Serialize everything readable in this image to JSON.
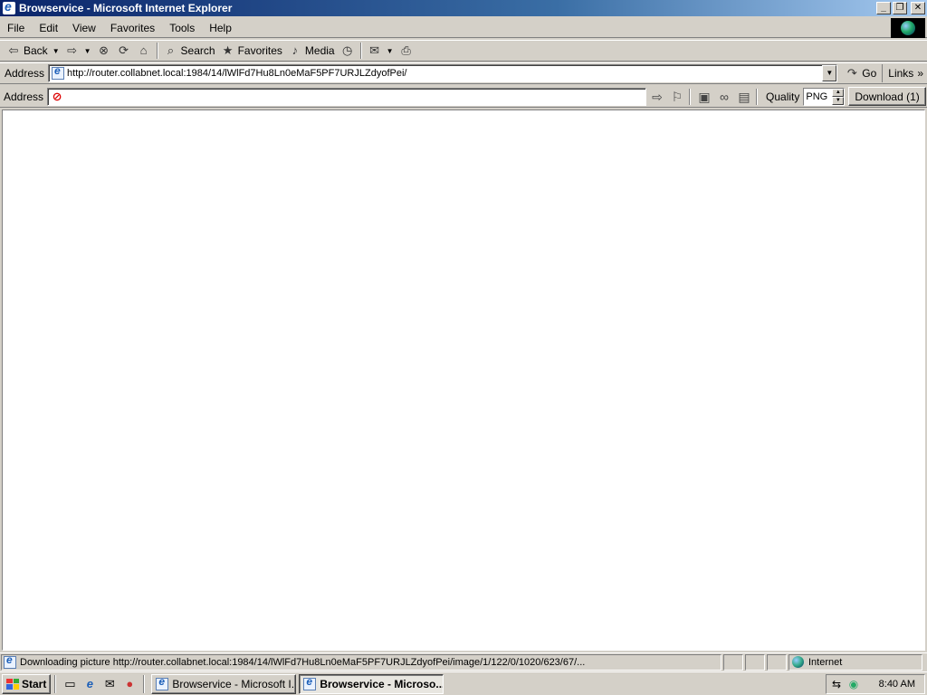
{
  "window": {
    "title": "Browservice - Microsoft Internet Explorer"
  },
  "menu": {
    "items": [
      "File",
      "Edit",
      "View",
      "Favorites",
      "Tools",
      "Help"
    ]
  },
  "toolbar": {
    "back_label": "Back",
    "search_label": "Search",
    "favorites_label": "Favorites",
    "media_label": "Media"
  },
  "addressbar": {
    "label": "Address",
    "url": "http://router.collabnet.local:1984/14/lWlFd7Hu8Ln0eMaF5PF7URJLZdyofPei/",
    "go_label": "Go",
    "links_label": "Links"
  },
  "browservice": {
    "address_label": "Address",
    "address_value": "",
    "quality_label": "Quality",
    "quality_value": "PNG",
    "download_label": "Download (1)"
  },
  "status": {
    "text": "Downloading picture http://router.collabnet.local:1984/14/lWlFd7Hu8Ln0eMaF5PF7URJLZdyofPei/image/1/122/0/1020/623/67/...",
    "zone": "Internet"
  },
  "taskbar": {
    "start_label": "Start",
    "tasks": [
      {
        "label": "Browservice - Microsoft I...",
        "active": false
      },
      {
        "label": "Browservice - Microso...",
        "active": true
      }
    ],
    "clock": "8:40 AM"
  }
}
